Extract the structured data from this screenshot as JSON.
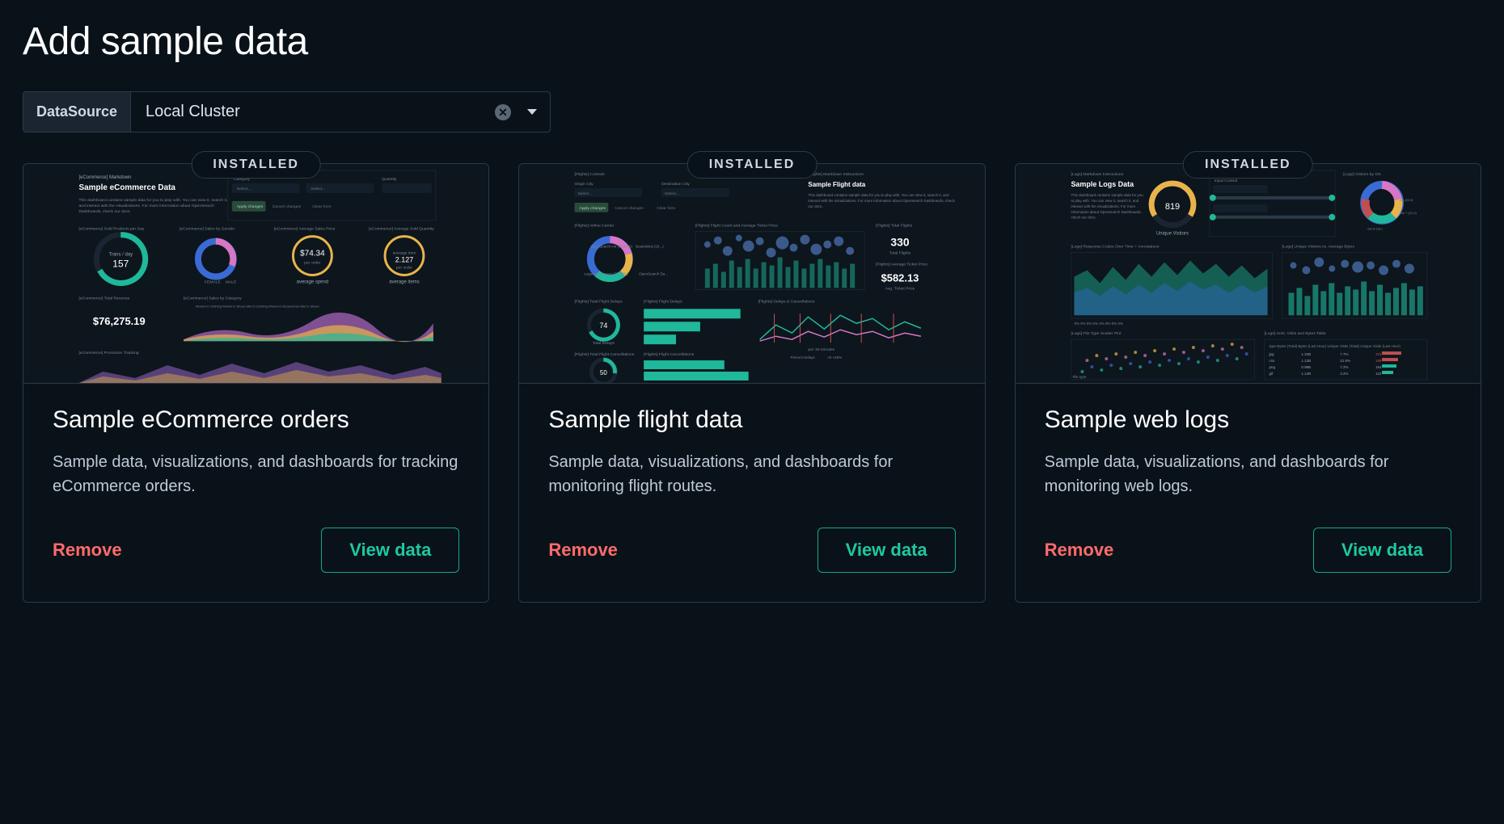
{
  "page_title": "Add sample data",
  "datasource": {
    "label": "DataSource",
    "value": "Local Cluster"
  },
  "badge_label": "INSTALLED",
  "remove_label": "Remove",
  "view_label": "View data",
  "cards": [
    {
      "title": "Sample eCommerce orders",
      "description": "Sample data, visualizations, and dashboards for tracking eCommerce orders.",
      "preview": {
        "heading": "Sample eCommerce Data",
        "metrics": {
          "trans_day_label": "Trans / day",
          "trans_day_value": "157",
          "avg_spend": "$74.34",
          "avg_spend_label": "average spend",
          "avg_items": "2.127",
          "avg_items_sub": "per order",
          "avg_items_label": "average items",
          "total_revenue": "$76,275.19"
        }
      }
    },
    {
      "title": "Sample flight data",
      "description": "Sample data, visualizations, and dashboards for monitoring flight routes.",
      "preview": {
        "heading": "Sample Flight data",
        "metrics": {
          "total_flights": "330",
          "total_flights_label": "Total Flights",
          "avg_ticket_price": "$582.13",
          "avg_ticket_label": "Avg. Ticket Price",
          "gauge_a": "74",
          "gauge_b": "50"
        }
      }
    },
    {
      "title": "Sample web logs",
      "description": "Sample data, visualizations, and dashboards for monitoring web logs.",
      "preview": {
        "heading": "Sample Logs Data",
        "metrics": {
          "unique_visitors": "819",
          "unique_visitors_label": "Unique Visitors"
        }
      }
    }
  ]
}
